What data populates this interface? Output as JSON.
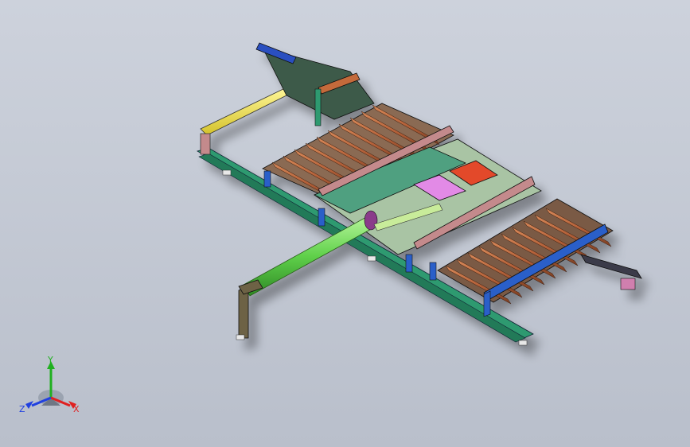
{
  "viewport": {
    "background_top": "#cdd2dc",
    "background_bottom": "#b9bfcb"
  },
  "model": {
    "colors": {
      "roller": "#b5623a",
      "frame_green": "#2e9a70",
      "frame_blue": "#2a5fc9",
      "beam_yellow": "#f0e24a",
      "beam_green": "#5fd04a",
      "plate": "#a9c4a4",
      "pink_beam": "#c48a8c",
      "magenta": "#e28ae6",
      "red_plate": "#e34a2b",
      "olive": "#6d6245",
      "bracket_pink": "#d07fae"
    }
  },
  "triad": {
    "x_label": "X",
    "y_label": "Y",
    "z_label": "Z",
    "x_color": "#e02020",
    "y_color": "#20b020",
    "z_color": "#2040e0"
  }
}
